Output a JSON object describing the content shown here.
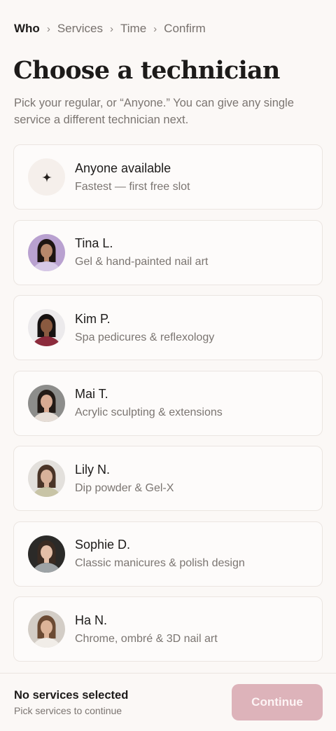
{
  "breadcrumb": {
    "steps": [
      "Who",
      "Services",
      "Time",
      "Confirm"
    ],
    "separator": "›",
    "active_index": 0
  },
  "page": {
    "title": "Choose a technician",
    "subtitle": "Pick your regular, or “Anyone.” You can give any single service a different technician next."
  },
  "technicians": [
    {
      "name": "Anyone available",
      "specialty": "Fastest — first free slot",
      "avatar": "sparkle-icon"
    },
    {
      "name": "Tina L.",
      "specialty": "Gel & hand-painted nail art",
      "avatar": "photo",
      "colors": {
        "bg": "#b9a1d0",
        "hair": "#1e1512",
        "skin": "#b7876b",
        "top": "#d6c8e6"
      }
    },
    {
      "name": "Kim P.",
      "specialty": "Spa pedicures & reflexology",
      "avatar": "photo",
      "colors": {
        "bg": "#eceaec",
        "hair": "#161111",
        "skin": "#8a5a40",
        "top": "#8c2b3c"
      }
    },
    {
      "name": "Mai T.",
      "specialty": "Acrylic sculpting & extensions",
      "avatar": "photo",
      "colors": {
        "bg": "#8d8d8b",
        "hair": "#231a16",
        "skin": "#d9ab93",
        "top": "#e6ddd6"
      }
    },
    {
      "name": "Lily N.",
      "specialty": "Dip powder & Gel-X",
      "avatar": "photo",
      "colors": {
        "bg": "#e3e0dc",
        "hair": "#4a3427",
        "skin": "#d8b29a",
        "top": "#c8c4a6"
      }
    },
    {
      "name": "Sophie D.",
      "specialty": "Classic manicures & polish design",
      "avatar": "photo",
      "colors": {
        "bg": "#2b2a28",
        "hair": "#3a2b22",
        "skin": "#e4bfa8",
        "top": "#9ea3a6"
      }
    },
    {
      "name": "Ha N.",
      "specialty": "Chrome, ombré & 3D nail art",
      "avatar": "photo",
      "colors": {
        "bg": "#d3cdc6",
        "hair": "#6b4a33",
        "skin": "#dcb499",
        "top": "#f1ede8"
      }
    }
  ],
  "footer": {
    "title": "No services selected",
    "hint": "Pick services to continue",
    "button_label": "Continue"
  },
  "colors": {
    "accent_disabled": "#ddb3ba",
    "background": "#fbf8f6"
  }
}
